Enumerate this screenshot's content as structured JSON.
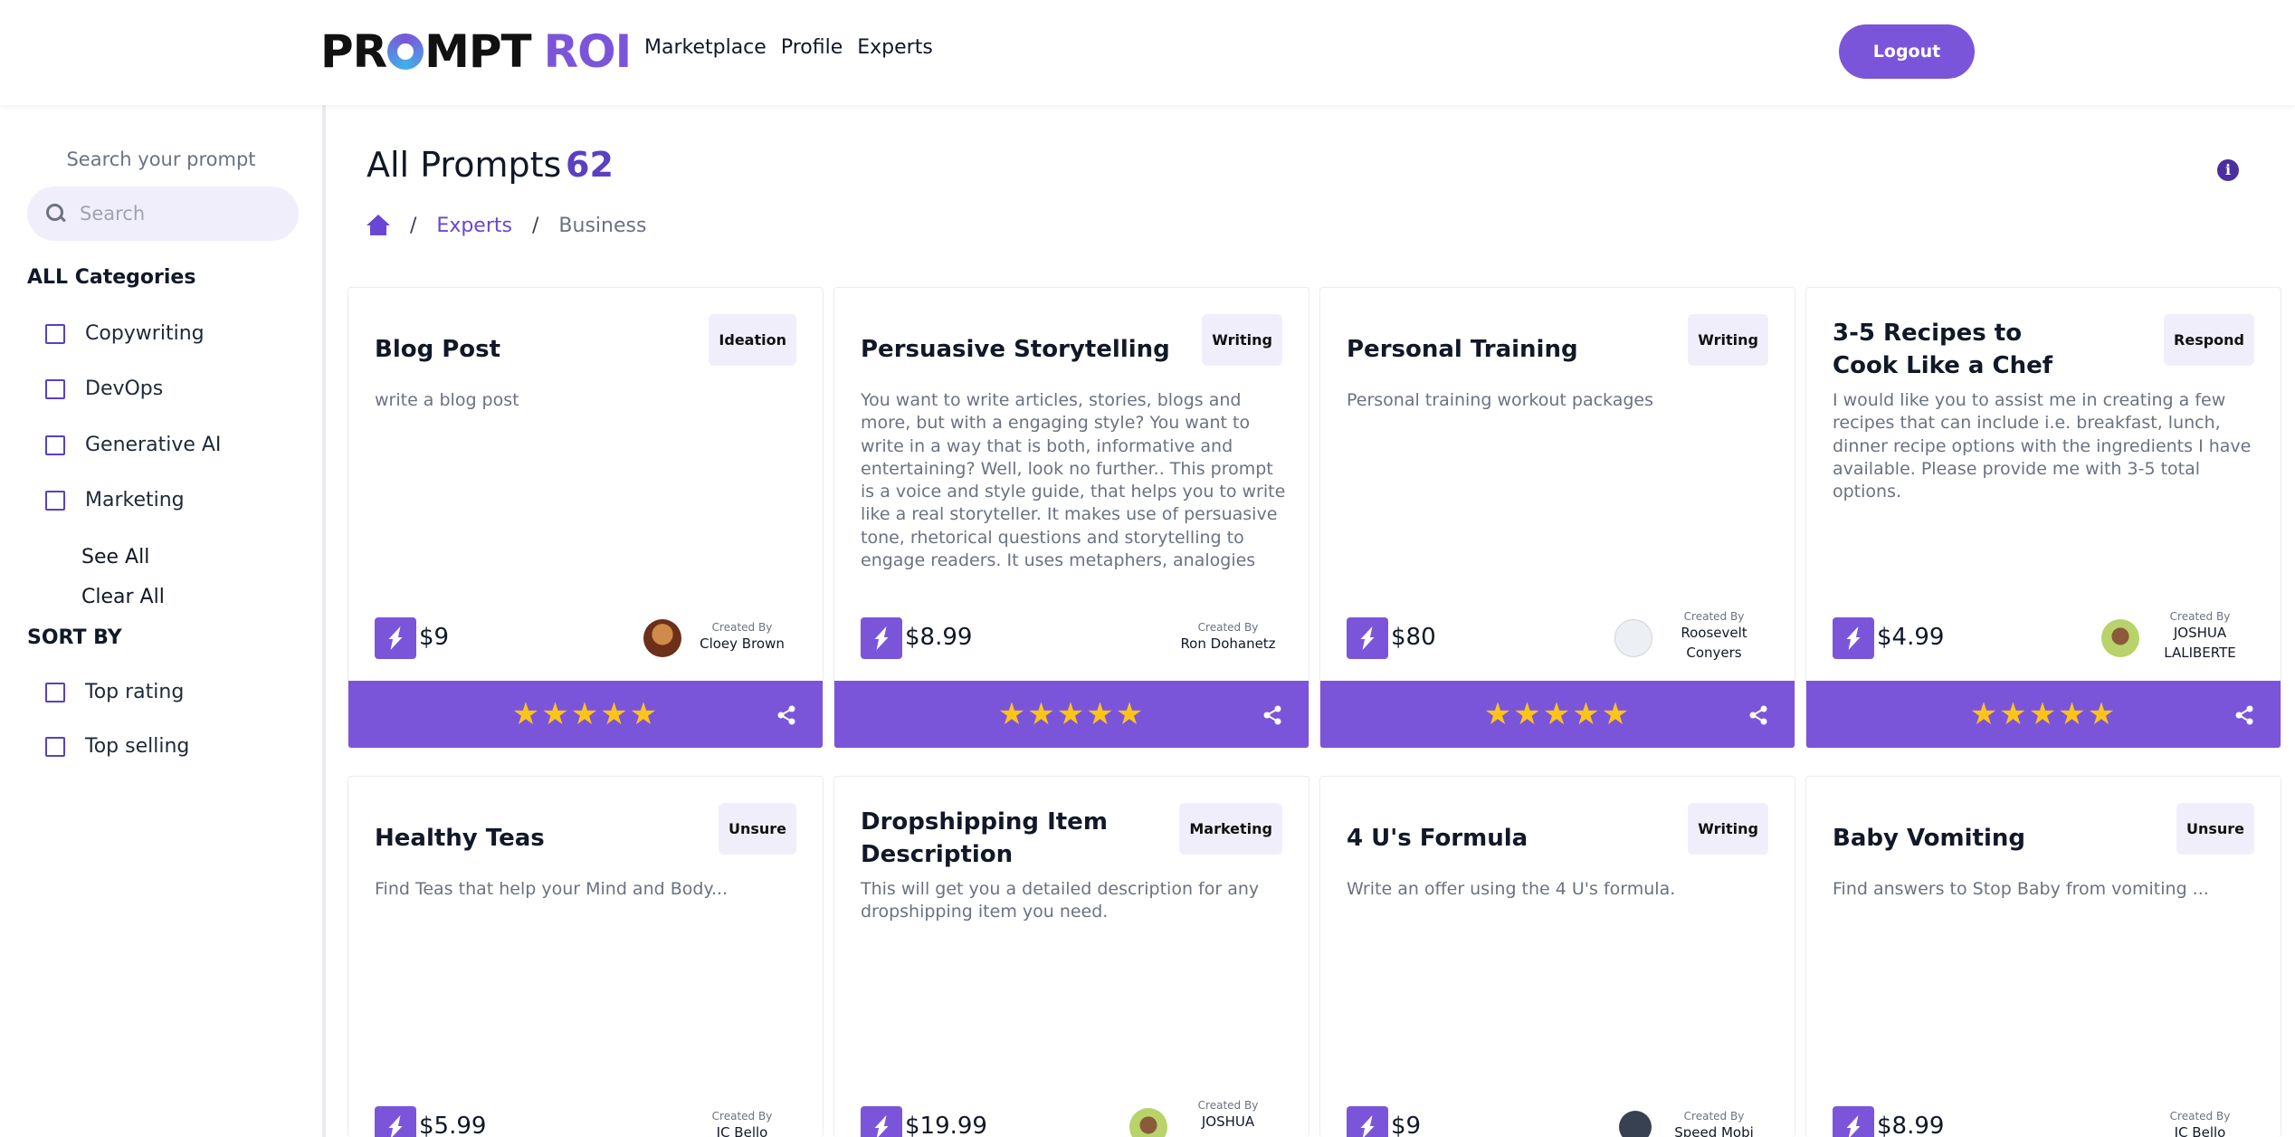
{
  "header": {
    "logo_dark": "PR",
    "logo_dark2": "MPT",
    "logo_purple": "ROI",
    "nav": [
      "Marketplace",
      "Profile",
      "Experts"
    ],
    "logout_label": "Logout"
  },
  "sidebar": {
    "search_label": "Search your prompt",
    "search_placeholder": "Search",
    "search_value": "",
    "categories_title": "ALL Categories",
    "categories": [
      "Copywriting",
      "DevOps",
      "Generative AI",
      "Marketing"
    ],
    "see_all": "See All",
    "clear_all": "Clear All",
    "sort_title": "SORT BY",
    "sort_options": [
      "Top rating",
      "Top selling"
    ]
  },
  "main": {
    "title": "All Prompts",
    "count": "62",
    "breadcrumb": {
      "link": "Experts",
      "current": "Business",
      "separator": "/"
    }
  },
  "cards": [
    {
      "title": "Blog Post",
      "tag": "Ideation",
      "description": "write a blog post",
      "price": "$9",
      "created_by_label": "Created By",
      "creator": "Cloey Brown",
      "rating": "★★★★★",
      "avatar_color": "#8a4b2a"
    },
    {
      "title": "Persuasive Storytelling",
      "tag": "Writing",
      "description": "You want to write articles, stories, blogs and more, but with a engaging style? You want to write in a way that is both, informative and entertaining? Well, look no further.. This prompt is a voice and style guide, that helps you to write like a real storyteller. It makes use of persuasive tone, rhetorical questions and storytelling to engage readers. It uses metaphers, analogies and other...",
      "price": "$8.99",
      "created_by_label": "Created By",
      "creator": "Ron Dohanetz",
      "rating": "★★★★★",
      "avatar_color": ""
    },
    {
      "title": "Personal Training",
      "tag": "Writing",
      "description": "Personal training workout packages",
      "price": "$80",
      "created_by_label": "Created By",
      "creator": "Roosevelt Conyers",
      "rating": "★★★★★",
      "avatar_color": "#e5e7eb"
    },
    {
      "title": "3-5 Recipes to Cook Like a Chef",
      "tag": "Respond",
      "description": "I would like you to assist me in creating a few recipes that can include i.e. breakfast, lunch, dinner recipe options with the ingredients I have available. Please provide me with 3-5 total options.",
      "price": "$4.99",
      "created_by_label": "Created By",
      "creator": "JOSHUA LALIBERTE",
      "rating": "★★★★★",
      "avatar_color": "#a3c45a"
    },
    {
      "title": "Healthy Teas",
      "tag": "Unsure",
      "description": "Find Teas that help your Mind and Body...",
      "price": "$5.99",
      "created_by_label": "Created By",
      "creator": "JC Bello",
      "rating": "",
      "avatar_color": ""
    },
    {
      "title": "Dropshipping Item Description",
      "tag": "Marketing",
      "description": "This will get you a detailed description for any dropshipping item you need.",
      "price": "$19.99",
      "created_by_label": "Created By",
      "creator": "JOSHUA",
      "rating": "",
      "avatar_color": "#a3c45a"
    },
    {
      "title": "4 U's Formula",
      "tag": "Writing",
      "description": "Write an offer using the 4 U's formula.",
      "price": "$9",
      "created_by_label": "Created By",
      "creator": "Speed Mobi",
      "rating": "",
      "avatar_color": "#374151"
    },
    {
      "title": "Baby Vomiting",
      "tag": "Unsure",
      "description": "Find answers to Stop Baby from vomiting ...",
      "price": "$8.99",
      "created_by_label": "Created By",
      "creator": "JC Bello",
      "rating": "",
      "avatar_color": ""
    }
  ],
  "colors": {
    "accent": "#7b55d9",
    "star": "#fcc419",
    "tag_bg": "#f1eefc"
  },
  "icons": [
    "search-icon",
    "home-icon",
    "info-icon",
    "lightning-icon",
    "share-icon",
    "star-icon"
  ]
}
